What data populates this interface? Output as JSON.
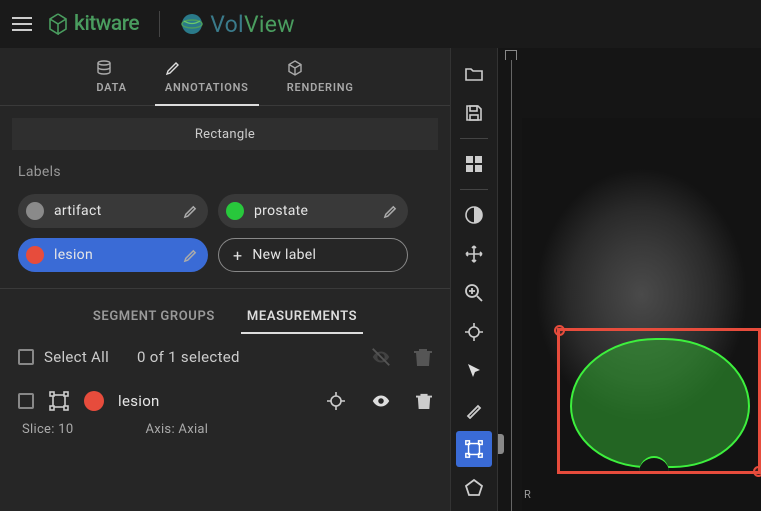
{
  "header": {
    "brand1": "kitware",
    "brand2a": "Vol",
    "brand2b": "View"
  },
  "tabs": [
    {
      "label": "DATA"
    },
    {
      "label": "ANNOTATIONS"
    },
    {
      "label": "RENDERING"
    }
  ],
  "active_tab": 1,
  "tool": "Rectangle",
  "labels_title": "Labels",
  "labels": [
    {
      "name": "artifact",
      "color": "#8a8a8a",
      "selected": false
    },
    {
      "name": "prostate",
      "color": "#28c83c",
      "selected": false
    },
    {
      "name": "lesion",
      "color": "#e74c3c",
      "selected": true
    }
  ],
  "new_label": "New label",
  "subtabs": [
    {
      "label": "SEGMENT GROUPS"
    },
    {
      "label": "MEASUREMENTS"
    }
  ],
  "active_subtab": 1,
  "select_all": "Select All",
  "selected_text": "0 of 1 selected",
  "items": [
    {
      "name": "lesion",
      "color": "#e74c3c",
      "slice": "Slice: 10",
      "axis": "Axis: Axial"
    }
  ],
  "viewport": {
    "axis_label": "R",
    "rect_color": "#e74c3c",
    "segment_color": "#28c83c"
  }
}
